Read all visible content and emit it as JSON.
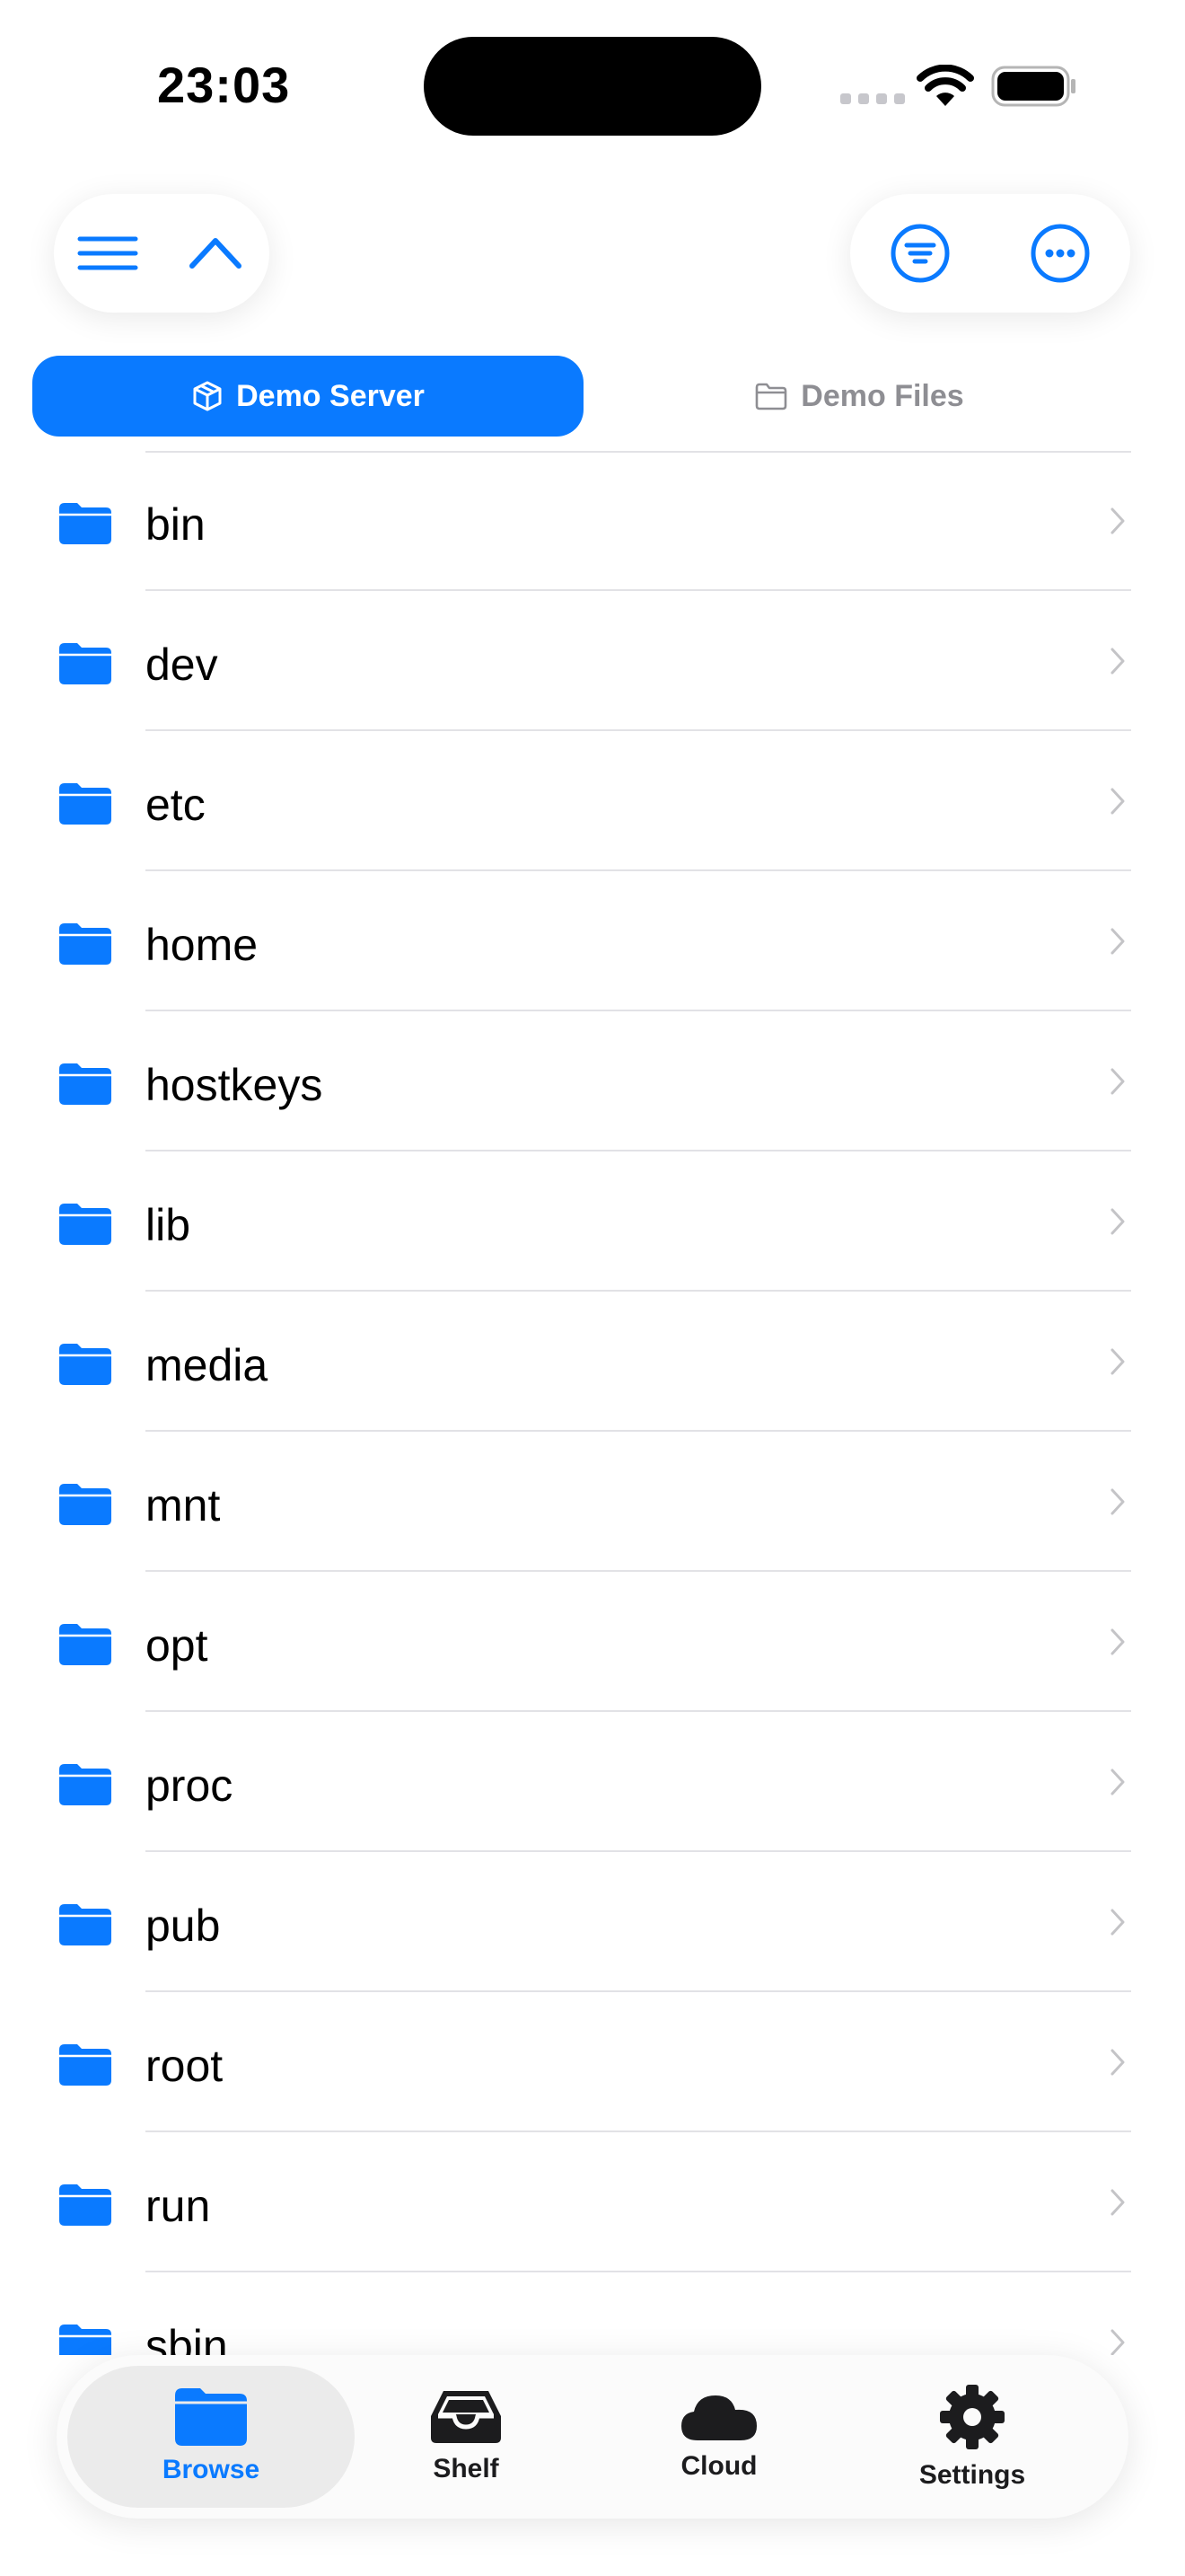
{
  "status_bar": {
    "time": "23:03"
  },
  "toolbar": {
    "left": [
      "hamburger-icon",
      "chevron-up-icon"
    ],
    "right": [
      "filter-circle-icon",
      "ellipsis-circle-icon"
    ]
  },
  "source_tabs": [
    {
      "label": "Demo Server",
      "icon": "cube-icon",
      "active": true
    },
    {
      "label": "Demo Files",
      "icon": "folder-outline-icon",
      "active": false
    }
  ],
  "folders": [
    {
      "name": "bin"
    },
    {
      "name": "dev"
    },
    {
      "name": "etc"
    },
    {
      "name": "home"
    },
    {
      "name": "hostkeys"
    },
    {
      "name": "lib"
    },
    {
      "name": "media"
    },
    {
      "name": "mnt"
    },
    {
      "name": "opt"
    },
    {
      "name": "proc"
    },
    {
      "name": "pub"
    },
    {
      "name": "root"
    },
    {
      "name": "run"
    },
    {
      "name": "sbin"
    }
  ],
  "tab_bar": [
    {
      "label": "Browse",
      "icon": "folder-icon",
      "selected": true
    },
    {
      "label": "Shelf",
      "icon": "tray-icon",
      "selected": false
    },
    {
      "label": "Cloud",
      "icon": "cloud-icon",
      "selected": false
    },
    {
      "label": "Settings",
      "icon": "gear-icon",
      "selected": false
    }
  ],
  "colors": {
    "accent": "#0a7aff",
    "separator": "#e2e2e6",
    "secondary_text": "#8e8e93"
  }
}
